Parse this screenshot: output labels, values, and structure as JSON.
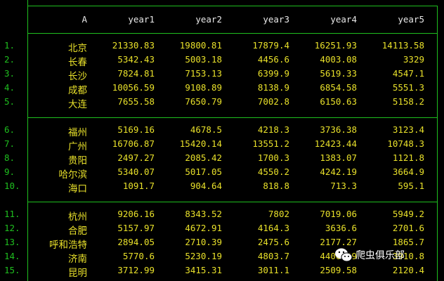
{
  "table": {
    "headers": [
      "A",
      "year1",
      "year2",
      "year3",
      "year4",
      "year5"
    ],
    "groups": [
      [
        {
          "n": "1.",
          "name": "北京",
          "v": [
            "21330.83",
            "19800.81",
            "17879.4",
            "16251.93",
            "14113.58"
          ]
        },
        {
          "n": "2.",
          "name": "长春",
          "v": [
            "5342.43",
            "5003.18",
            "4456.6",
            "4003.08",
            "3329"
          ]
        },
        {
          "n": "3.",
          "name": "长沙",
          "v": [
            "7824.81",
            "7153.13",
            "6399.9",
            "5619.33",
            "4547.1"
          ]
        },
        {
          "n": "4.",
          "name": "成都",
          "v": [
            "10056.59",
            "9108.89",
            "8138.9",
            "6854.58",
            "5551.3"
          ]
        },
        {
          "n": "5.",
          "name": "大连",
          "v": [
            "7655.58",
            "7650.79",
            "7002.8",
            "6150.63",
            "5158.2"
          ]
        }
      ],
      [
        {
          "n": "6.",
          "name": "福州",
          "v": [
            "5169.16",
            "4678.5",
            "4218.3",
            "3736.38",
            "3123.4"
          ]
        },
        {
          "n": "7.",
          "name": "广州",
          "v": [
            "16706.87",
            "15420.14",
            "13551.2",
            "12423.44",
            "10748.3"
          ]
        },
        {
          "n": "8.",
          "name": "贵阳",
          "v": [
            "2497.27",
            "2085.42",
            "1700.3",
            "1383.07",
            "1121.8"
          ]
        },
        {
          "n": "9.",
          "name": "哈尔滨",
          "v": [
            "5340.07",
            "5017.05",
            "4550.2",
            "4242.19",
            "3664.9"
          ]
        },
        {
          "n": "10.",
          "name": "海口",
          "v": [
            "1091.7",
            "904.64",
            "818.8",
            "713.3",
            "595.1"
          ]
        }
      ],
      [
        {
          "n": "11.",
          "name": "杭州",
          "v": [
            "9206.16",
            "8343.52",
            "7802",
            "7019.06",
            "5949.2"
          ]
        },
        {
          "n": "12.",
          "name": "合肥",
          "v": [
            "5157.97",
            "4672.91",
            "4164.3",
            "3636.6",
            "2701.6"
          ]
        },
        {
          "n": "13.",
          "name": "呼和浩特",
          "v": [
            "2894.05",
            "2710.39",
            "2475.6",
            "2177.27",
            "1865.7"
          ]
        },
        {
          "n": "14.",
          "name": "济南",
          "v": [
            "5770.6",
            "5230.19",
            "4803.7",
            "4406.29",
            "3910.8"
          ]
        },
        {
          "n": "15.",
          "name": "昆明",
          "v": [
            "3712.99",
            "3415.31",
            "3011.1",
            "2509.58",
            "2120.4"
          ]
        }
      ]
    ]
  },
  "watermark": {
    "text": "爬虫俱乐部",
    "icon": "wechat-icon"
  },
  "colors": {
    "grid": "#1fbf1f",
    "value": "#e8e02a",
    "header": "#e8e8e8",
    "background": "#000000"
  }
}
